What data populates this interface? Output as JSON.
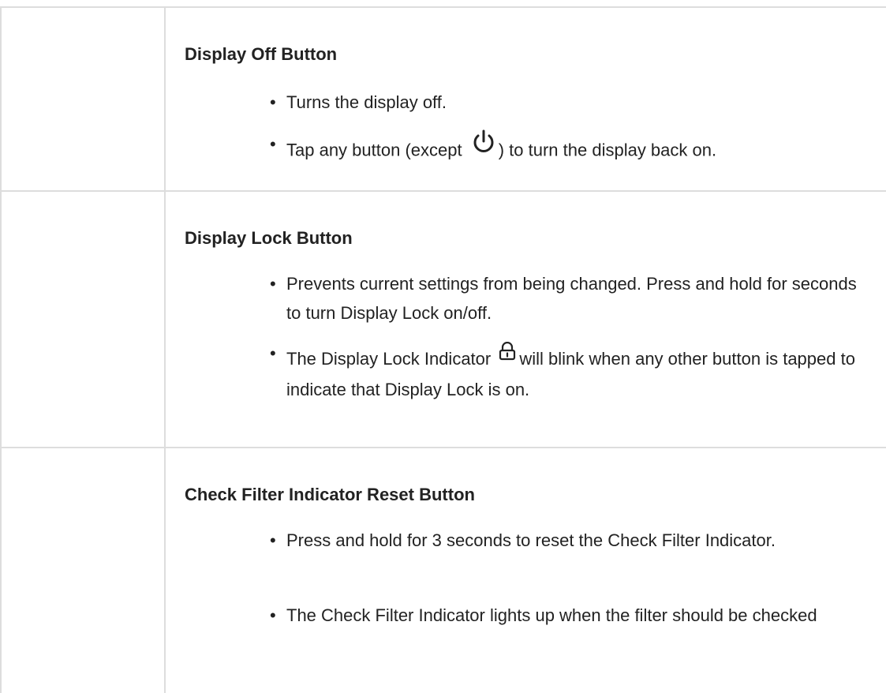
{
  "rows": [
    {
      "title": "Display Off Button",
      "bullets": [
        {
          "before": "Turns the display off.",
          "icon": null,
          "after": ""
        },
        {
          "before": "Tap any button (except",
          "icon": "power-icon",
          "after": ") to turn the display back on."
        }
      ]
    },
    {
      "title": "Display Lock Button",
      "bullets": [
        {
          "before": "Prevents current settings from being changed. Press and hold for seconds to turn Display Lock on/off.",
          "icon": null,
          "after": ""
        },
        {
          "before": "The Display Lock Indicator",
          "icon": "lock-icon",
          "after": "will blink when any other button is tapped to indicate that Display Lock is on."
        }
      ]
    },
    {
      "title": "Check Filter Indicator Reset Button",
      "bullets": [
        {
          "before": "Press and hold for 3 seconds to reset the Check Filter Indicator.",
          "icon": null,
          "after": ""
        },
        {
          "before": "The Check Filter Indicator lights up when the filter should be checked",
          "icon": null,
          "after": ""
        }
      ]
    }
  ],
  "bullet_char": "•",
  "colors": {
    "text": "#222222",
    "border": "#dddddd",
    "background": "#ffffff"
  }
}
